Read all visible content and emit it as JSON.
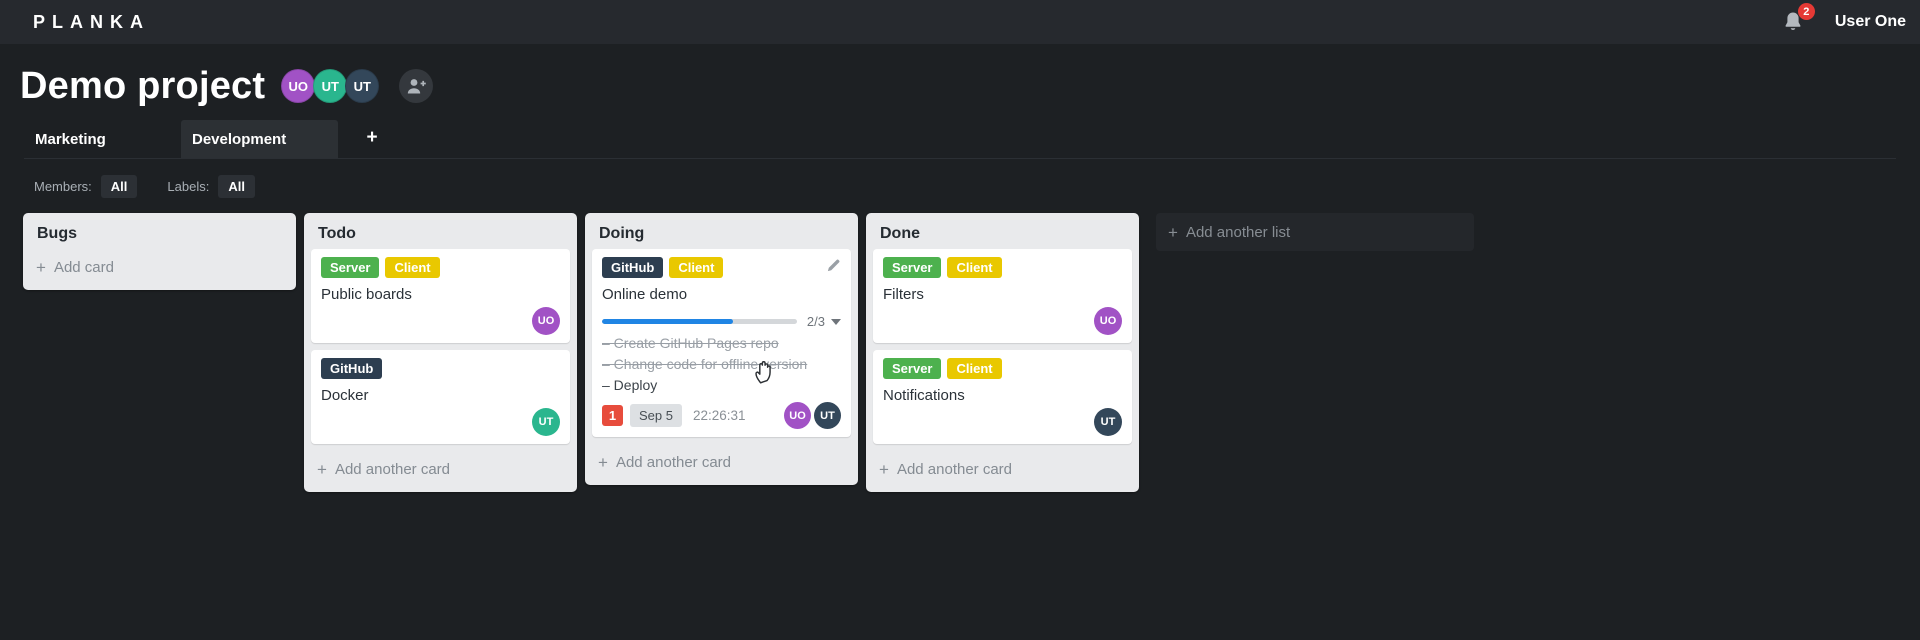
{
  "topbar": {
    "logo": "PLANKA",
    "user": "User One",
    "notification_count": "2"
  },
  "project": {
    "title": "Demo project",
    "members": [
      {
        "initials": "UO",
        "color": "#a152c5"
      },
      {
        "initials": "UT",
        "color": "#2ab68e"
      },
      {
        "initials": "UT",
        "color": "#33475a"
      }
    ]
  },
  "tabs": {
    "items": [
      {
        "label": "Marketing",
        "active": false
      },
      {
        "label": "Development",
        "active": true
      }
    ],
    "add_label": "+"
  },
  "filters": {
    "members_label": "Members:",
    "members_value": "All",
    "labels_label": "Labels:",
    "labels_value": "All"
  },
  "colors": {
    "label_green": "#4db14e",
    "label_yellow": "#e9c800",
    "label_navy": "#2d3e50",
    "progress_blue": "#2085e4",
    "count_red": "#e74c3c",
    "badge_red": "#e53935"
  },
  "board": {
    "add_list_label": "Add another list",
    "lists": [
      {
        "name": "Bugs",
        "add_label": "Add card",
        "cards": []
      },
      {
        "name": "Todo",
        "add_label": "Add another card",
        "cards": [
          {
            "title": "Public boards",
            "labels": [
              {
                "text": "Server",
                "color": "#4db14e"
              },
              {
                "text": "Client",
                "color": "#e9c800"
              }
            ],
            "members": [
              {
                "initials": "UO",
                "color": "#a152c5"
              }
            ]
          },
          {
            "title": "Docker",
            "labels": [
              {
                "text": "GitHub",
                "color": "#2d3e50"
              }
            ],
            "members": [
              {
                "initials": "UT",
                "color": "#2ab68e"
              }
            ]
          }
        ]
      },
      {
        "name": "Doing",
        "add_label": "Add another card",
        "cards": [
          {
            "title": "Online demo",
            "labels": [
              {
                "text": "GitHub",
                "color": "#2d3e50"
              },
              {
                "text": "Client",
                "color": "#e9c800"
              }
            ],
            "editable": true,
            "progress": {
              "label": "2/3",
              "percent": 67
            },
            "tasks": [
              {
                "text": "Create GitHub Pages repo",
                "done": true
              },
              {
                "text": "Change code for offline version",
                "done": true
              },
              {
                "text": "Deploy",
                "done": false
              }
            ],
            "badges": {
              "count": "1",
              "date": "Sep 5",
              "time": "22:26:31"
            },
            "members": [
              {
                "initials": "UO",
                "color": "#a152c5"
              },
              {
                "initials": "UT",
                "color": "#33475a"
              }
            ]
          }
        ]
      },
      {
        "name": "Done",
        "add_label": "Add another card",
        "cards": [
          {
            "title": "Filters",
            "labels": [
              {
                "text": "Server",
                "color": "#4db14e"
              },
              {
                "text": "Client",
                "color": "#e9c800"
              }
            ],
            "members": [
              {
                "initials": "UO",
                "color": "#a152c5"
              }
            ]
          },
          {
            "title": "Notifications",
            "labels": [
              {
                "text": "Server",
                "color": "#4db14e"
              },
              {
                "text": "Client",
                "color": "#e9c800"
              }
            ],
            "members": [
              {
                "initials": "UT",
                "color": "#33475a"
              }
            ]
          }
        ]
      }
    ]
  }
}
